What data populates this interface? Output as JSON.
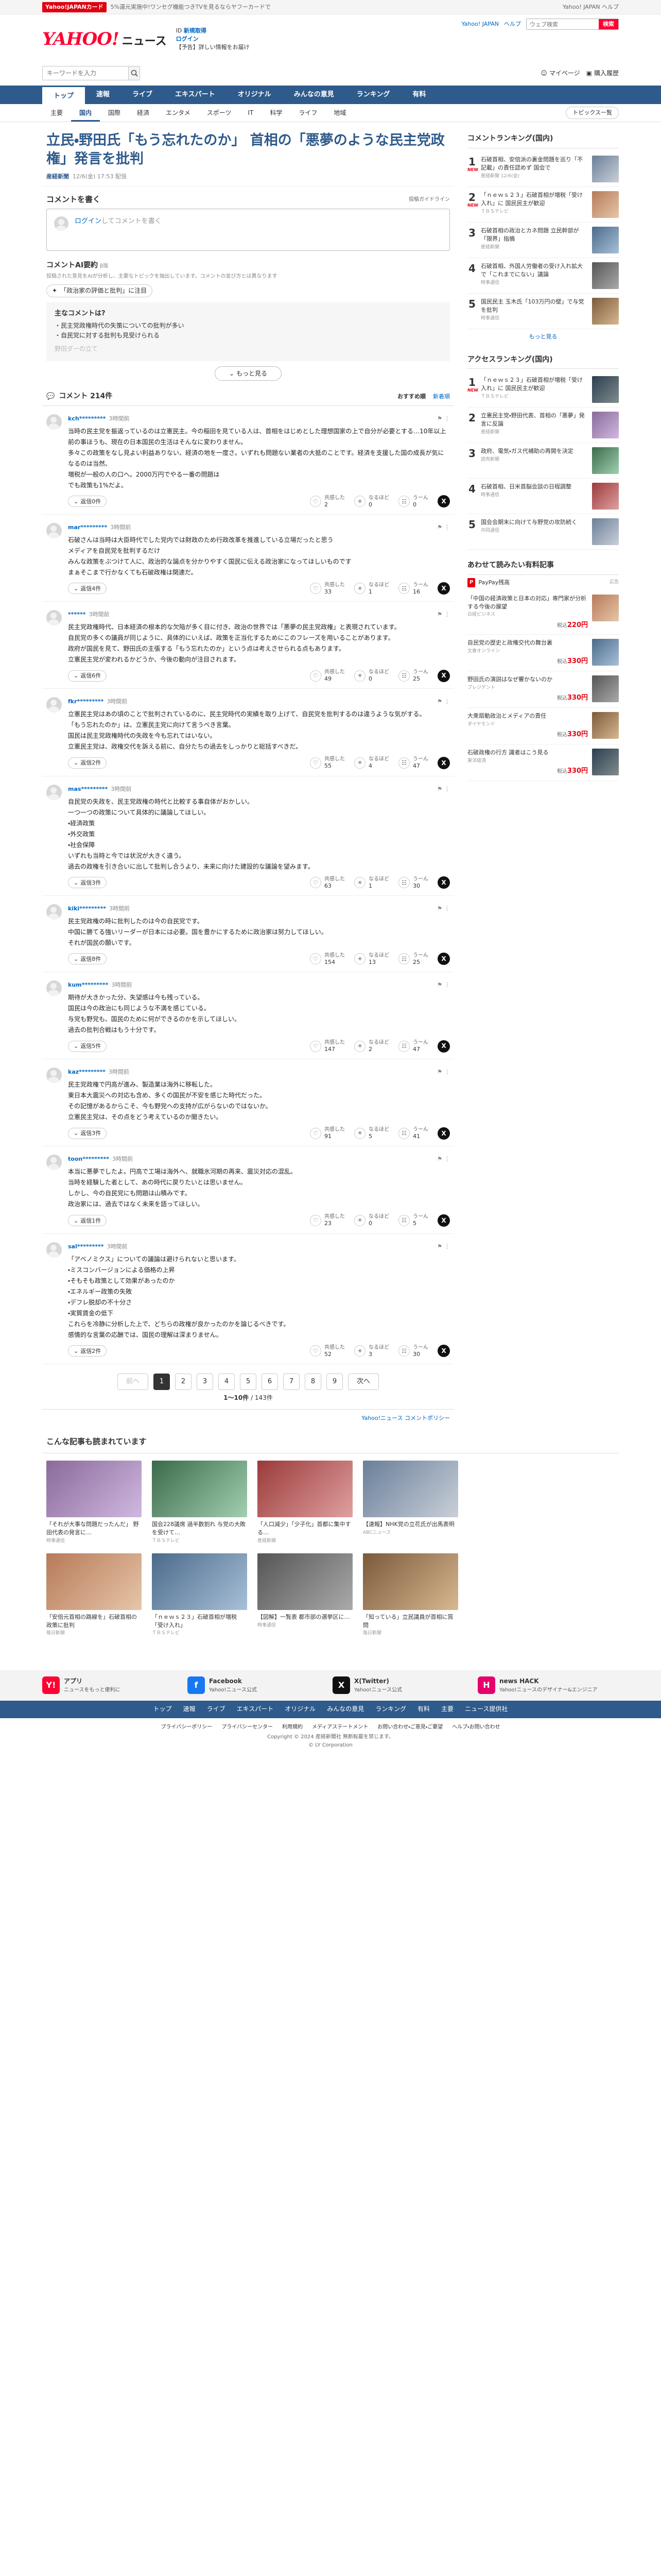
{
  "gbar": {
    "badge": "Yahoo!JAPANカード",
    "text": "5%還元実施中!ワンセグ機能つきTVを見るならヤフーカードで",
    "right": "Yahoo! JAPAN ヘルプ"
  },
  "header": {
    "logo": "YAHOO!",
    "logo_sub": "ニュース",
    "promo_line1": "ID",
    "promo_link1": "新規取得",
    "promo_line2": "ログイン",
    "promo_line3": "【予告】詳しい情報をお届け",
    "yahoo_link": "Yahoo! JAPAN",
    "help_link": "ヘルプ",
    "search_placeholder": "ウェブ検索",
    "search_button": "検索"
  },
  "search": {
    "placeholder": "キーワードを入力",
    "right": [
      "マイページ",
      "購入履歴"
    ]
  },
  "nav": [
    "トップ",
    "速報",
    "ライブ",
    "エキスパート",
    "オリジナル",
    "みんなの意見",
    "ランキング",
    "有料"
  ],
  "nav_active": 0,
  "subnav": [
    "主要",
    "国内",
    "国際",
    "経済",
    "エンタメ",
    "スポーツ",
    "IT",
    "科学",
    "ライフ",
    "地域"
  ],
  "subnav_active": 1,
  "pickup": "トピックス一覧",
  "article": {
    "title": "立民・野田氏「もう忘れたのか」 首相の「悪夢のような民主党政権」発言を批判",
    "source": "産経新聞",
    "date": "12/6(金) 17:53 配信"
  },
  "comment_form": {
    "heading": "コメントを書く",
    "guide": "投稿ガイドライン",
    "login": "ログイン",
    "placeholder": "してコメントを書く"
  },
  "ai": {
    "heading": "コメントAI要約",
    "beta": "β版",
    "note": "投稿された意見をAIが分析し、主要なトピックを抽出しています。コメントの並び方とは異なります",
    "tag": "「政治家の評価と批判」に注目",
    "summary_heading": "主なコメントは?",
    "summary": [
      "民主党政権時代の失策についての批判が多い",
      "自民党に対する批判も見受けられる"
    ],
    "fade": "野田ダーの立て",
    "more": "もっと見る"
  },
  "clist": {
    "title": "コメント",
    "count": "214件",
    "sorts": [
      "おすすめ順",
      "新着順"
    ]
  },
  "comments": [
    {
      "user": "kch*********",
      "ago": "3時間前",
      "text": "当時の民主党を振返っているのは立憲民主。今の稲田を見ている人は、首相をはじめとした理想国家の上で自分が必要とする…10年以上前の事ほうも、現在の日本国民の生活はそんなに変わりません。\n多々この政策をなし見よい利益ありない、経済の地を一度さ。いずれも問題ない業者の大抵のことです。経済を支援した国の成長が気になるのは当然、\n増税が一般の人の口へ。2000万円でやる一番の問題は\nでも政策も1%だよ。",
      "likes": "2",
      "likes_label": "共感した",
      "unclear": "0",
      "unclear_label": "なるほど",
      "helpful": "0",
      "helpful_label": "うーん",
      "replies": "返信0件"
    },
    {
      "user": "mar*********",
      "ago": "3時間前",
      "text": "石破さんは当時は大臣時代でした党内では財政のため行政改革を推進している立場だったと思う\nメディアを自民党を批判するだけ\nみんな政策をぶつけて人に、政治的な論点を分かりやすく国民に伝える政治家になってほしいものです\nまぁそこまで行かなくても石破政権は関連だ。",
      "likes": "33",
      "likes_label": "共感した",
      "unclear": "1",
      "unclear_label": "なるほど",
      "helpful": "16",
      "helpful_label": "うーん",
      "replies": "返信4件"
    },
    {
      "user": "******",
      "ago": "3時間前",
      "text": "民主党政権時代、日本経済の根本的な欠陥が多く目に付き、政治の世界では「悪夢の民主党政権」と表現されています。\n自民党の多くの議員が同じように、具体的にいえば、政策を正当化するためにこのフレーズを用いることがあります。\n政府が国民を見て、野田氏の主張する「もう忘れたのか」という点は考えさせられる点もあります。\n立憲民主党が変われるかどうか、今後の動向が注目されます。",
      "likes": "49",
      "likes_label": "共感した",
      "unclear": "0",
      "unclear_label": "なるほど",
      "helpful": "25",
      "helpful_label": "うーん",
      "replies": "返信6件"
    },
    {
      "user": "fkr*********",
      "ago": "3時間前",
      "text": "立憲民主党はあの頃のことで批判されているのに、民主党時代の実績を取り上げて、自民党を批判するのは違うような気がする。\n「もう忘れたのか」は、立憲民主党に向けて言うべき言葉。\n国民は民主党政権時代の失政を今も忘れてはいない。\n立憲民主党は、政権交代を訴える前に、自分たちの過去をしっかりと総括すべきだ。",
      "likes": "55",
      "likes_label": "共感した",
      "unclear": "4",
      "unclear_label": "なるほど",
      "helpful": "47",
      "helpful_label": "うーん",
      "replies": "返信2件"
    },
    {
      "user": "mas*********",
      "ago": "3時間前",
      "text": "自民党の失政を、民主党政権の時代と比較する事自体がおかしい。\n一つ一つの政策について具体的に議論してほしい。\n・経済政策\n・外交政策\n・社会保障\nいずれも当時と今では状況が大きく違う。\n過去の政権を引き合いに出して批判し合うより、未来に向けた建設的な議論を望みます。",
      "likes": "63",
      "likes_label": "共感した",
      "unclear": "1",
      "unclear_label": "なるほど",
      "helpful": "30",
      "helpful_label": "うーん",
      "replies": "返信3件"
    },
    {
      "user": "kiki*********",
      "ago": "3時間前",
      "text": "民主党政権の時に批判したのは今の自民党です。\n中国に勝てる強いリーダーが日本には必要。国を豊かにするために政治家は努力してほしい。\nそれが国民の願いです。",
      "likes": "154",
      "likes_label": "共感した",
      "unclear": "13",
      "unclear_label": "なるほど",
      "helpful": "25",
      "helpful_label": "うーん",
      "replies": "返信8件"
    },
    {
      "user": "kum*********",
      "ago": "3時間前",
      "text": "期待が大きかった分、失望感は今も残っている。\n国民は今の政治にも同じような不満を感じている。\n与党も野党も、国民のために何ができるのかを示してほしい。\n過去の批判合戦はもう十分です。",
      "likes": "147",
      "likes_label": "共感した",
      "unclear": "2",
      "unclear_label": "なるほど",
      "helpful": "47",
      "helpful_label": "うーん",
      "replies": "返信5件"
    },
    {
      "user": "kaz*********",
      "ago": "3時間前",
      "text": "民主党政権で円高が進み、製造業は海外に移転した。\n東日本大震災への対応も含め、多くの国民が不安を感じた時代だった。\nその記憶があるからこそ、今も野党への支持が広がらないのではないか。\n立憲民主党は、その点をどう考えているのか聞きたい。",
      "likes": "91",
      "likes_label": "共感した",
      "unclear": "5",
      "unclear_label": "なるほど",
      "helpful": "41",
      "helpful_label": "うーん",
      "replies": "返信3件"
    },
    {
      "user": "toon*********",
      "ago": "3時間前",
      "text": "本当に悪夢でしたよ。円高で工場は海外へ、就職氷河期の再来、震災対応の混乱。\n当時を経験した者として、あの時代に戻りたいとは思いません。\nしかし、今の自民党にも問題は山積みです。\n政治家には、過去ではなく未来を語ってほしい。",
      "likes": "23",
      "likes_label": "共感した",
      "unclear": "0",
      "unclear_label": "なるほど",
      "helpful": "5",
      "helpful_label": "うーん",
      "replies": "返信1件"
    },
    {
      "user": "sal*********",
      "ago": "3時間前",
      "text": "「アベノミクス」についての議論は避けられないと思います。\n・ミスコンバージョンによる価格の上昇\n・そもそも政策として効果があったのか\n・エネルギー政策の失敗\n・デフレ脱却の不十分さ\n・実質賃金の低下\nこれらを冷静に分析した上で、どちらの政権が良かったのかを論じるべきです。\n感情的な言葉の応酬では、国民の理解は深まりません。",
      "likes": "52",
      "likes_label": "共感した",
      "unclear": "3",
      "unclear_label": "なるほど",
      "helpful": "30",
      "helpful_label": "うーん",
      "replies": "返信2件"
    }
  ],
  "pager": {
    "prev": "前へ",
    "pages": [
      "1",
      "2",
      "3",
      "4",
      "5",
      "6",
      "7",
      "8",
      "9"
    ],
    "next": "次へ",
    "active": 0,
    "count_prefix": "1〜10件",
    "count_suffix": "/ 143件"
  },
  "policy": "Yahoo!ニュース コメントポリシー",
  "side_rank": {
    "heading": "コメントランキング(国内)",
    "items": [
      {
        "n": "1",
        "badge": "NEW",
        "text": "石破首相、安倍派の裏金問題を巡り「不記載」の責任認めず 国会で",
        "src": "産経新聞 12/6(金)",
        "th": "t1"
      },
      {
        "n": "2",
        "badge": "NEW",
        "text": "「ｎｅｗｓ２３」石破首相が増税「受け入れ」に 国民民主が歓迎",
        "src": "ＴＢＳテレビ",
        "th": "t2"
      },
      {
        "n": "3",
        "badge": "",
        "text": "石破首相の政治とカネ問題 立民幹部が「限界」指摘",
        "src": "産経新聞",
        "th": "t3"
      },
      {
        "n": "4",
        "badge": "",
        "text": "石破首相、外国人労働者の受け入れ拡大で「これまでにない」議論",
        "src": "時事通信",
        "th": "t4"
      },
      {
        "n": "5",
        "badge": "",
        "text": "国民民主 玉木氏「103万円の壁」で与党を批判",
        "src": "時事通信",
        "th": "t5"
      }
    ],
    "more": "もっと見る"
  },
  "side_access": {
    "heading": "アクセスランキング(国内)",
    "items": [
      {
        "n": "1",
        "badge": "NEW",
        "text": "「ｎｅｗｓ２３」石破首相が増税「受け入れ」に 国民民主が歓迎",
        "src": "ＴＢＳテレビ",
        "th": "t6"
      },
      {
        "n": "2",
        "badge": "",
        "text": "立憲民主党・野田代表、首相の「悪夢」発言に反論",
        "src": "産経新聞",
        "th": "t7"
      },
      {
        "n": "3",
        "badge": "",
        "text": "政府、電気・ガス代補助の再開を決定",
        "src": "読売新聞",
        "th": "t8"
      },
      {
        "n": "4",
        "badge": "",
        "text": "石破首相、日米首脳会談の日程調整",
        "src": "時事通信",
        "th": "t9"
      },
      {
        "n": "5",
        "badge": "",
        "text": "国会会期末に向けて与野党の攻防続く",
        "src": "共同通信",
        "th": "t1"
      }
    ]
  },
  "side_products": {
    "heading": "あわせて読みたい有料記事",
    "pay": "PayPay残高",
    "ad": "広告",
    "items": [
      {
        "text": "「中国の経済政策と日本の対応」専門家が分析する今後の展望",
        "src": "日経ビジネス",
        "price_label": "税込",
        "price": "220円",
        "th": "t2"
      },
      {
        "text": "自民党の歴史と政権交代の舞台裏",
        "src": "文春オンライン",
        "price_label": "税込",
        "price": "330円",
        "th": "t3"
      },
      {
        "text": "野田氏の演説はなぜ響かないのか",
        "src": "プレジデント",
        "price_label": "税込",
        "price": "330円",
        "th": "t4"
      },
      {
        "text": "大衆扇動政治とメディアの責任",
        "src": "ダイヤモンド",
        "price_label": "税込",
        "price": "330円",
        "th": "t5"
      },
      {
        "text": "石破政権の行方 識者はこう見る",
        "src": "東洋経済",
        "price_label": "税込",
        "price": "330円",
        "th": "t6"
      }
    ]
  },
  "rec": {
    "heading": "こんな記事も読まれています",
    "items": [
      {
        "text": "「それが大事な問題だったんだ」 野田代表の発言に…",
        "src": "時事通信",
        "th": "t7"
      },
      {
        "text": "国会228議席 過半数割れ 与党の大敗を受けて…",
        "src": "ＴＢＳテレビ",
        "th": "t8"
      },
      {
        "text": "「人口減少」「少子化」首都に集中する…",
        "src": "産経新聞",
        "th": "t9"
      },
      {
        "text": "【速報】NHK党の立花氏が出馬表明",
        "src": "ABCニュース",
        "th": "t1"
      },
      {
        "text": "「安倍元首相の路線を」石破首相の政策に批判",
        "src": "毎日新聞",
        "th": "t2"
      },
      {
        "text": "「ｎｅｗｓ２３」石破首相が増税「受け入れ」",
        "src": "ＴＢＳテレビ",
        "th": "t3"
      },
      {
        "text": "【図解】一覧表 都市部の選挙区に…",
        "src": "時事通信",
        "th": "t4"
      },
      {
        "text": "「知っている」立民議員が首相に質問",
        "src": "毎日新聞",
        "th": "t5"
      }
    ]
  },
  "footer": {
    "apps": [
      {
        "name": "アプリ",
        "desc": "ニュースをもっと便利に",
        "icon": "Y!",
        "color": "#ff0033"
      },
      {
        "name": "Facebook",
        "desc": "Yahoo!ニュース公式",
        "icon": "f",
        "color": "#1877f2"
      },
      {
        "name": "X(Twitter)",
        "desc": "Yahoo!ニュース公式",
        "icon": "X",
        "color": "#111111"
      },
      {
        "name": "news HACK",
        "desc": "Yahoo!ニュースのデザイナー&エンジニア",
        "icon": "H",
        "color": "#e6006e"
      }
    ],
    "nav": [
      "トップ",
      "速報",
      "ライブ",
      "エキスパート",
      "オリジナル",
      "みんなの意見",
      "ランキング",
      "有料",
      "主要",
      "ニュース提供社"
    ],
    "links": [
      "プライバシーポリシー",
      "プライバシーセンター",
      "利用規約",
      "メディアステートメント",
      "お問い合わせ・ご意見・ご要望",
      "ヘルプ・お問い合わせ"
    ],
    "copy": "Copyright © 2024 産経新聞社 無断転載を禁じます。",
    "copy2": "© LY Corporation"
  }
}
